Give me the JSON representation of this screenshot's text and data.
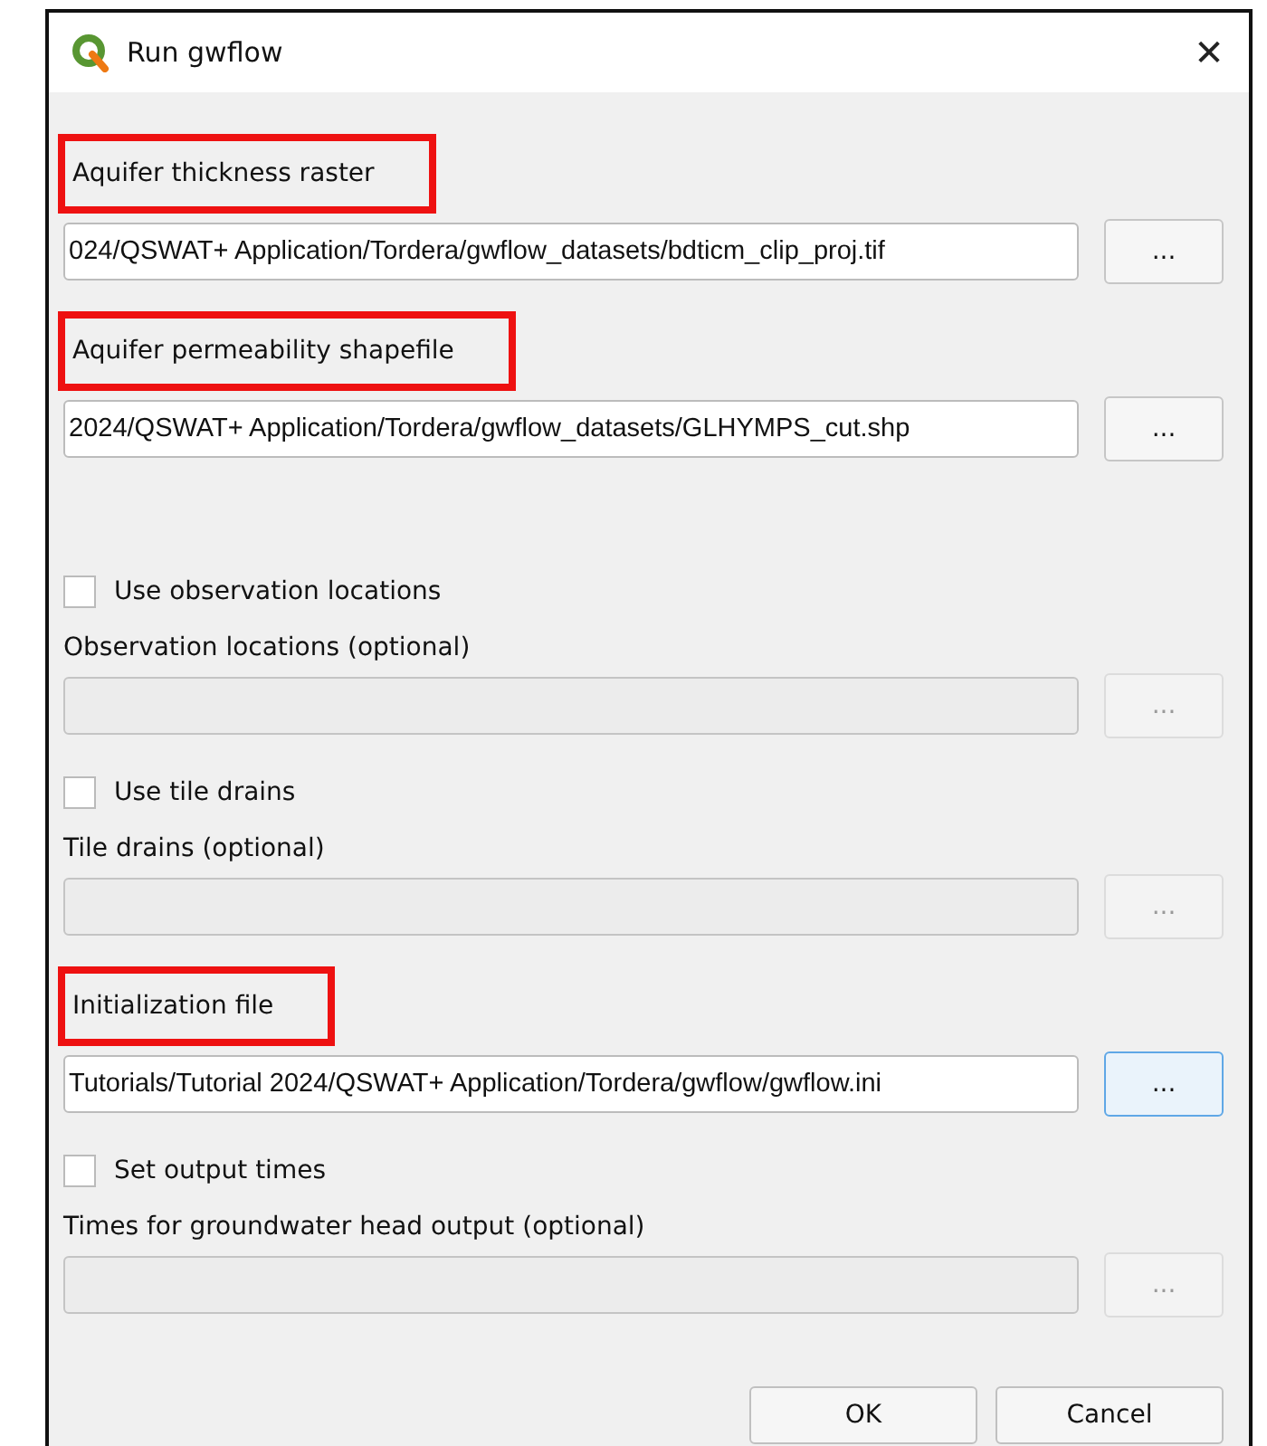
{
  "window": {
    "title": "Run gwflow",
    "close": "✕"
  },
  "groups": [
    {
      "rows": [
        {
          "kind": "label",
          "text": "Aquifer thickness raster",
          "highlighted": true
        },
        {
          "kind": "file",
          "value": "024/QSWAT+ Application/Tordera/gwflow_datasets/bdticm_clip_proj.tif",
          "disabled": false,
          "button": "...",
          "focused": false
        },
        {
          "kind": "label",
          "text": "Aquifer permeability shapefile",
          "highlighted": true
        },
        {
          "kind": "file",
          "value": "2024/QSWAT+ Application/Tordera/gwflow_datasets/GLHYMPS_cut.shp",
          "disabled": false,
          "button": "...",
          "focused": false
        }
      ]
    },
    {
      "rows": [
        {
          "kind": "checkbox",
          "text": "Use observation locations",
          "checked": false
        },
        {
          "kind": "label",
          "text": "Observation locations (optional)",
          "highlighted": false
        },
        {
          "kind": "file",
          "disabled": true,
          "button": "...",
          "focused": false
        },
        {
          "kind": "checkbox",
          "text": "Use tile drains",
          "checked": false
        },
        {
          "kind": "label",
          "text": "Tile drains (optional)",
          "highlighted": false
        },
        {
          "kind": "file",
          "disabled": true,
          "button": "...",
          "focused": false
        },
        {
          "kind": "label",
          "text": "Initialization file",
          "highlighted": true
        },
        {
          "kind": "file",
          "value": "Tutorials/Tutorial 2024/QSWAT+ Application/Tordera/gwflow/gwflow.ini",
          "disabled": false,
          "button": "...",
          "focused": true
        },
        {
          "kind": "checkbox",
          "text": "Set output times",
          "checked": false
        },
        {
          "kind": "label",
          "text": "Times for groundwater head output (optional)",
          "highlighted": false
        },
        {
          "kind": "file",
          "disabled": true,
          "button": "...",
          "focused": false
        }
      ]
    }
  ],
  "buttons": [
    "OK",
    "Cancel"
  ]
}
